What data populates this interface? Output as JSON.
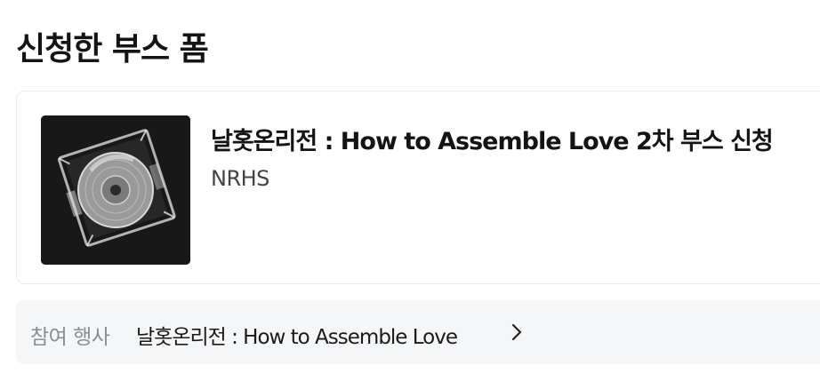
{
  "section": {
    "title": "신청한 부스 폼"
  },
  "form_card": {
    "title": "날홋온리전 : How to Assemble Love 2차 부스 신청",
    "organizer": "NRHS",
    "thumbnail_icon": "cd-disc-image"
  },
  "event_row": {
    "label": "참여 행사",
    "name": "날홋온리전 : How to Assemble Love",
    "chevron_icon": "chevron-right-icon"
  }
}
